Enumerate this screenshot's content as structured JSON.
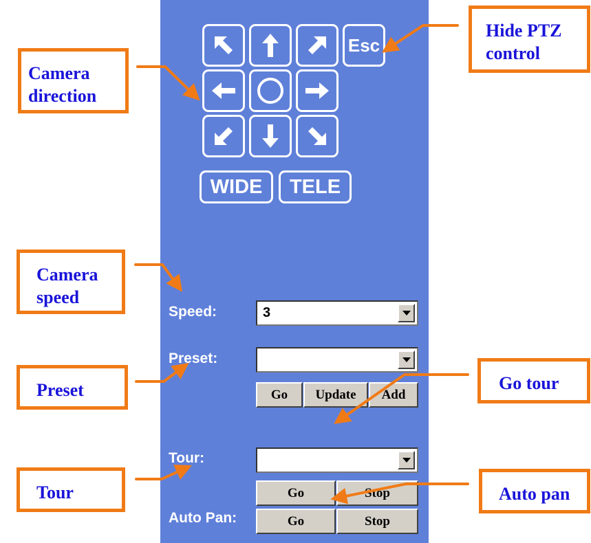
{
  "ptz": {
    "esc_label": "Esc",
    "wide_label": "WIDE",
    "tele_label": "TELE"
  },
  "speed": {
    "label": "Speed:",
    "value": "3"
  },
  "preset": {
    "label": "Preset:",
    "value": "",
    "go_label": "Go",
    "update_label": "Update",
    "add_label": "Add"
  },
  "tour": {
    "label": "Tour:",
    "value": "",
    "go_label": "Go",
    "stop_label": "Stop"
  },
  "auto_pan": {
    "label": "Auto Pan:",
    "go_label": "Go",
    "stop_label": "Stop"
  },
  "annotations": {
    "camera_direction_1": "Camera",
    "camera_direction_2": "direction",
    "hide_ptz_1": "Hide PTZ",
    "hide_ptz_2": "control",
    "camera_speed_1": "Camera",
    "camera_speed_2": "speed",
    "preset": "Preset",
    "go_tour": "Go tour",
    "tour": "Tour",
    "auto_pan": "Auto pan"
  },
  "colors": {
    "panel": "#5f80d9",
    "annotation_border": "#f07b16",
    "annotation_text": "#1a14d9",
    "button_face": "#d4d0c8"
  },
  "icons": [
    "arrow-up-left-icon",
    "arrow-up-icon",
    "arrow-up-right-icon",
    "arrow-left-icon",
    "circle-home-icon",
    "arrow-right-icon",
    "arrow-down-left-icon",
    "arrow-down-icon",
    "arrow-down-right-icon",
    "dropdown-arrow-icon"
  ]
}
